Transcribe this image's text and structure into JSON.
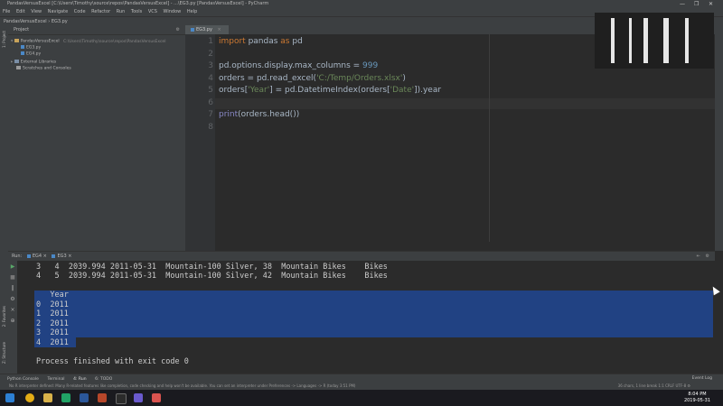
{
  "window": {
    "title": "PandasVersusExcel [C:\\Users\\Timothy\\source\\repos\\PandasVersusExcel] - ...\\EG3.py [PandasVersusExcel] - PyCharm",
    "controls": [
      "—",
      "❐",
      "✕"
    ]
  },
  "menu": [
    "File",
    "Edit",
    "View",
    "Navigate",
    "Code",
    "Refactor",
    "Run",
    "Tools",
    "VCS",
    "Window",
    "Help"
  ],
  "navbar": {
    "path": "PandasVersusExcel  ›  EG3.py"
  },
  "project_panel": {
    "header": "Project",
    "left_tab": "1: Project",
    "tree": {
      "root": "PandasVersusExcel",
      "root_path": "C:\\Users\\Timothy\\source\\repos\\PandasVersusExcel",
      "files": [
        "EG3.py",
        "EG4.py"
      ],
      "external": "External Libraries",
      "scratches": "Scratches and Consoles"
    }
  },
  "editor": {
    "tab": "EG3.py",
    "lines": [
      {
        "n": "1",
        "parts": [
          {
            "t": "import",
            "c": "kw"
          },
          {
            "t": " pandas ",
            "c": ""
          },
          {
            "t": "as",
            "c": "kw"
          },
          {
            "t": " pd",
            "c": ""
          }
        ]
      },
      {
        "n": "2",
        "parts": []
      },
      {
        "n": "3",
        "parts": [
          {
            "t": "pd.options.display.max_columns = ",
            "c": ""
          },
          {
            "t": "999",
            "c": "num"
          }
        ]
      },
      {
        "n": "4",
        "parts": [
          {
            "t": "orders = pd.read_excel(",
            "c": ""
          },
          {
            "t": "'C:/Temp/Orders.xlsx'",
            "c": "str"
          },
          {
            "t": ")",
            "c": ""
          }
        ]
      },
      {
        "n": "5",
        "parts": [
          {
            "t": "orders[",
            "c": ""
          },
          {
            "t": "'Year'",
            "c": "str"
          },
          {
            "t": "] = pd.DatetimeIndex(orders[",
            "c": ""
          },
          {
            "t": "'Date'",
            "c": "str"
          },
          {
            "t": "]).year",
            "c": ""
          }
        ]
      },
      {
        "n": "6",
        "parts": []
      },
      {
        "n": "7",
        "parts": [
          {
            "t": "print",
            "c": "bi"
          },
          {
            "t": "(orders.head())",
            "c": ""
          }
        ]
      },
      {
        "n": "8",
        "parts": []
      }
    ]
  },
  "run_panel": {
    "label": "Run:",
    "tabs": [
      "EG4",
      "EG3"
    ],
    "console_lines": [
      "3   4  2039.994 2011-05-31  Mountain-100 Silver, 38  Mountain Bikes    Bikes",
      "4   5  2039.994 2011-05-31  Mountain-100 Silver, 42  Mountain Bikes    Bikes",
      "",
      "   Year",
      "0  2011",
      "1  2011",
      "2  2011",
      "3  2011",
      "4  2011",
      "",
      "Process finished with exit code 0"
    ],
    "side_labels": [
      "2: Favorites",
      "Z: Structure"
    ]
  },
  "bottom_tools": [
    "Python Console",
    "Terminal",
    "4: Run",
    "6: TODO"
  ],
  "event_log": "Event Log",
  "status": {
    "message": "No R interpreter defined: Many R-related features like completion, code checking and help won't be available. You can set an interpreter under Preferences -> Languages -> R (today 3:51 PM)",
    "position": "36 chars, 1 line break   1:1   CRLF   UTF-8   ⚙"
  },
  "taskbar": {
    "time": "8:04 PM",
    "date": "2019-05-31"
  },
  "colors": {
    "editor_bg": "#2b2b2b",
    "panel_bg": "#3c3f41",
    "keyword": "#cc7832",
    "number": "#6897bb",
    "string": "#6a8759",
    "builtin": "#8888c6",
    "selection": "#214283"
  }
}
